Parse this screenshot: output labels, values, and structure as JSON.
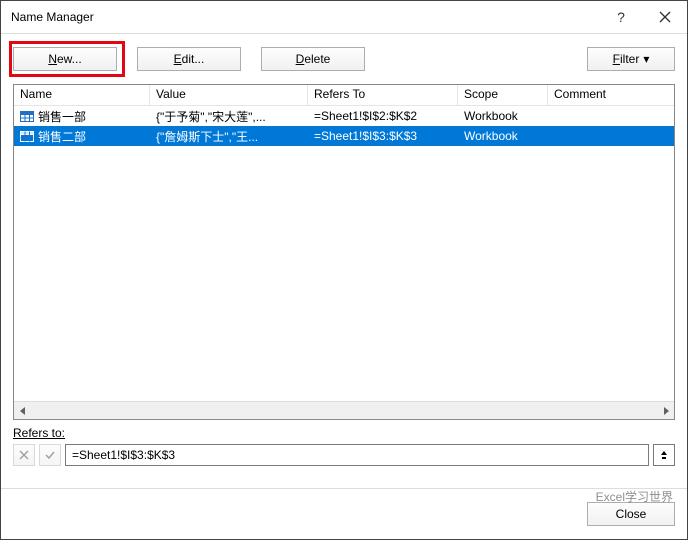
{
  "window": {
    "title": "Name Manager"
  },
  "buttons": {
    "new_pre": "N",
    "new_post": "ew...",
    "edit_pre": "E",
    "edit_post": "dit...",
    "delete_pre": "D",
    "delete_post": "elete",
    "filter_pre": "F",
    "filter_post": "ilter",
    "close": "Close"
  },
  "columns": {
    "name": "Name",
    "value": "Value",
    "refers": "Refers To",
    "scope": "Scope",
    "comment": "Comment"
  },
  "rows": [
    {
      "name": "销售一部",
      "value": "{\"于予菊\",\"宋大莲\",...",
      "refers": "=Sheet1!$I$2:$K$2",
      "scope": "Workbook",
      "comment": "",
      "selected": false
    },
    {
      "name": "销售二部",
      "value": "{\"詹姆斯下士\",\"王...",
      "refers": "=Sheet1!$I$3:$K$3",
      "scope": "Workbook",
      "comment": "",
      "selected": true
    }
  ],
  "refers_to": {
    "label": "Refers to:",
    "value": "=Sheet1!$I$3:$K$3"
  },
  "watermark": "Excel学习世界"
}
